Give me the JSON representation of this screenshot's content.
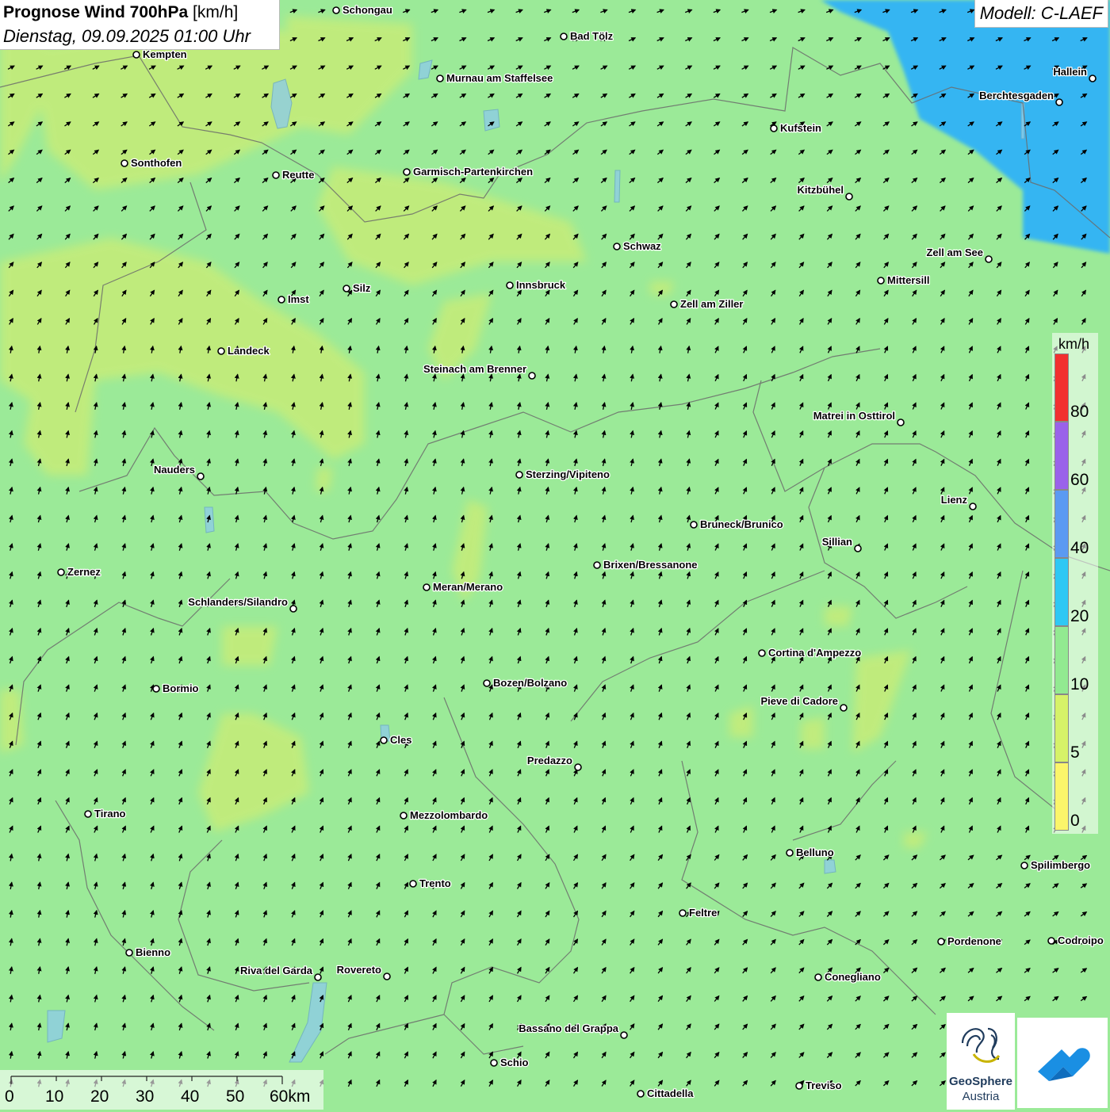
{
  "header": {
    "title_bold": "Prognose Wind 700hPa",
    "title_unit": "[km/h]",
    "subtitle": "Dienstag, 09.09.2025 01:00 Uhr",
    "model": "Modell: C-LAEF"
  },
  "legend": {
    "unit": "km/h",
    "segments": [
      {
        "label": "0",
        "color": "#fbf56a"
      },
      {
        "label": "5",
        "color": "#d6f268"
      },
      {
        "label": "10",
        "color": "#92ea91"
      },
      {
        "label": "20",
        "color": "#2ec8f4"
      },
      {
        "label": "40",
        "color": "#5b9af2"
      },
      {
        "label": "60",
        "color": "#9a62ea"
      },
      {
        "label": "80",
        "color": "#f2302f"
      }
    ]
  },
  "scalebar": {
    "labels": [
      "0",
      "10",
      "20",
      "30",
      "40",
      "50",
      "60km"
    ]
  },
  "logos": {
    "geosphere_line1": "GeoSphere",
    "geosphere_line2": "Austria"
  },
  "cities": [
    {
      "name": "Schongau",
      "lx": 0,
      "ly": 0
    },
    {
      "name": "Kempten"
    },
    {
      "name": "Bad Tölz"
    },
    {
      "name": "Murnau am Staffelsee"
    },
    {
      "name": "Hallein"
    },
    {
      "name": "Berchtesgaden"
    },
    {
      "name": "Kufstein"
    },
    {
      "name": "Sonthofen"
    },
    {
      "name": "Reutte"
    },
    {
      "name": "Garmisch-Partenkirchen"
    },
    {
      "name": "Kitzbühel"
    },
    {
      "name": "Schwaz"
    },
    {
      "name": "Zell am See"
    },
    {
      "name": "Mittersill"
    },
    {
      "name": "Innsbruck"
    },
    {
      "name": "Imst"
    },
    {
      "name": "Silz"
    },
    {
      "name": "Zell am Ziller"
    },
    {
      "name": "Landeck"
    },
    {
      "name": "Steinach am Brenner"
    },
    {
      "name": "Matrei in Osttirol"
    },
    {
      "name": "Nauders"
    },
    {
      "name": "Sterzing/Vipiteno"
    },
    {
      "name": "Lienz"
    },
    {
      "name": "Bruneck/Brunico"
    },
    {
      "name": "Sillian"
    },
    {
      "name": "Zernez"
    },
    {
      "name": "Brixen/Bressanone"
    },
    {
      "name": "Meran/Merano"
    },
    {
      "name": "Schlanders/Silandro"
    },
    {
      "name": "Cortina d'Ampezzo"
    },
    {
      "name": "Bormio"
    },
    {
      "name": "Bozen/Bolzano"
    },
    {
      "name": "Pieve di Cadore"
    },
    {
      "name": "Cles"
    },
    {
      "name": "Predazzo"
    },
    {
      "name": "Tirano"
    },
    {
      "name": "Mezzolombardo"
    },
    {
      "name": "Belluno"
    },
    {
      "name": "Spilimbergo"
    },
    {
      "name": "Trento"
    },
    {
      "name": "Feltre"
    },
    {
      "name": "Bienno"
    },
    {
      "name": "Pordenone"
    },
    {
      "name": "Codroipo"
    },
    {
      "name": "Riva del Garda"
    },
    {
      "name": "Rovereto"
    },
    {
      "name": "Conegliano"
    },
    {
      "name": "Bassano del Grappa"
    },
    {
      "name": "Schio"
    },
    {
      "name": "Treviso"
    },
    {
      "name": "Cittadella"
    }
  ]
}
